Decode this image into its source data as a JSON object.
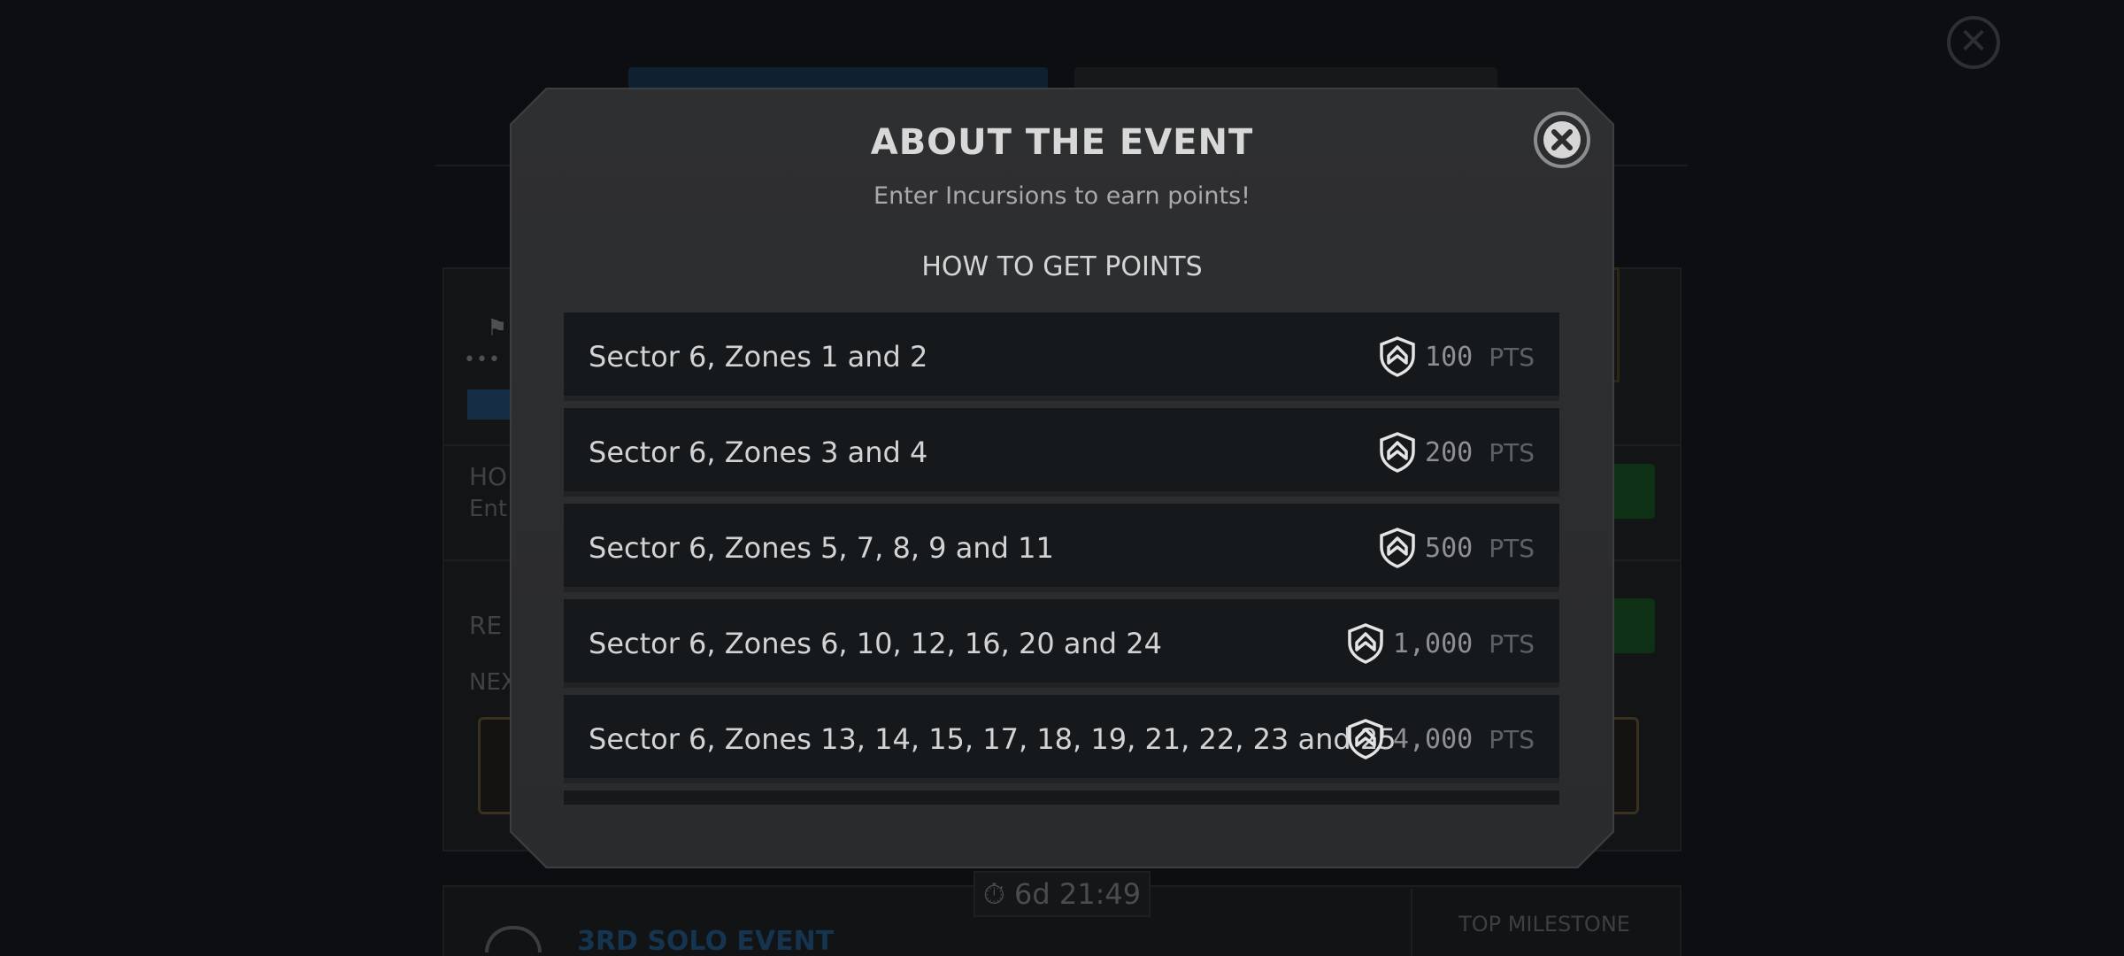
{
  "background": {
    "close_icon": "close-icon",
    "timer": "6d 21:49",
    "left_panel": {
      "heading_partial": "HO",
      "subtext_partial": "Ent",
      "rewards_partial": "RE",
      "next_partial": "NEX"
    },
    "bottom": {
      "event_name_partial": "3RD SOLO EVENT",
      "milestone_label": "TOP MILESTONE"
    }
  },
  "modal": {
    "title": "ABOUT THE EVENT",
    "subtitle": "Enter Incursions to earn points!",
    "section_heading": "HOW TO GET POINTS",
    "close_icon": "close-circle-icon",
    "points_suffix": "PTS",
    "rows": [
      {
        "label": "Sector 6, Zones 1 and 2",
        "points": "100"
      },
      {
        "label": "Sector 6, Zones 3 and 4",
        "points": "200"
      },
      {
        "label": "Sector 6, Zones 5, 7, 8, 9 and 11",
        "points": "500"
      },
      {
        "label": "Sector 6, Zones 6, 10, 12, 16, 20 and 24",
        "points": "1,000"
      },
      {
        "label": "Sector 6, Zones 13, 14, 15, 17, 18, 19, 21, 22, 23 and 25",
        "points": "4,000"
      }
    ]
  },
  "colors": {
    "modal_bg": "#2e2f31",
    "row_bg": "#16191c",
    "text_primary": "#d2d3d4",
    "text_points": "#8d8f92"
  }
}
